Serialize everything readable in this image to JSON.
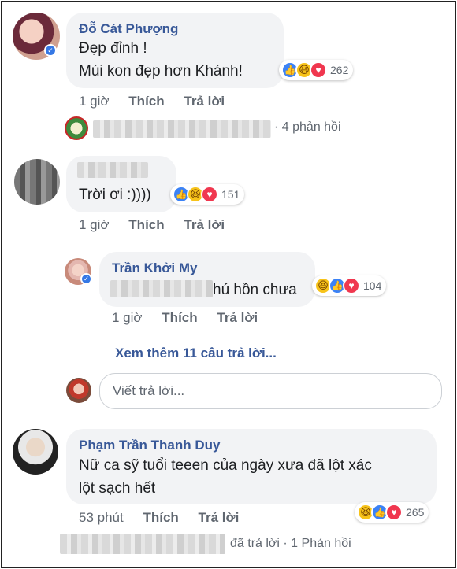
{
  "comments": {
    "c1": {
      "author": "Đỗ Cát Phượng",
      "line1": "Đẹp đỉnh !",
      "line2": "Múi kon đẹp hơn Khánh!",
      "reactions": "262",
      "time": "1 giờ",
      "like": "Thích",
      "reply": "Trả lời",
      "replies_summary": "· 4 phản hồi"
    },
    "c2": {
      "text": "Trời ơi :))))",
      "reactions": "151",
      "time": "1 giờ",
      "like": "Thích",
      "reply": "Trả lời"
    },
    "c2_reply": {
      "author": "Trần Khởi My",
      "text": "hú hồn chưa",
      "reactions": "104",
      "time": "1 giờ",
      "like": "Thích",
      "reply": "Trả lời"
    },
    "more_replies": "Xem thêm 11 câu trả lời...",
    "reply_placeholder": "Viết trả lời...",
    "c3": {
      "author": "Phạm Trần Thanh Duy",
      "line1": "Nữ ca sỹ tuổi teeen của ngày xưa đã lột xác",
      "line2": "lột sạch hết",
      "reactions": "265",
      "time": "53 phút",
      "like": "Thích",
      "reply": "Trả lời",
      "replies_summary": "đã trả lời · 1 Phản hồi"
    }
  },
  "colors": {
    "name": "#385898",
    "bubble": "#f2f3f5",
    "meta": "#606770",
    "like": "#3b82f6",
    "love": "#f0374f",
    "haha": "#f7c31a"
  }
}
